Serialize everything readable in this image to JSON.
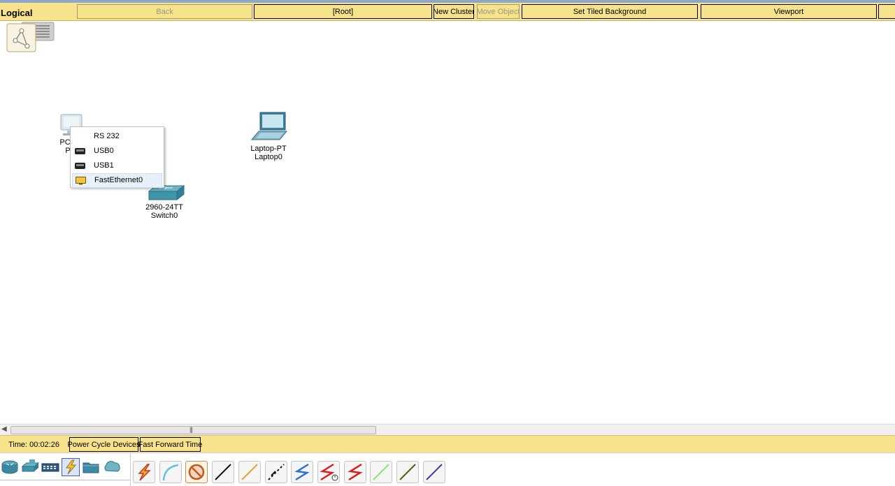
{
  "toolbar": {
    "mode_label": "Logical",
    "back_label": "Back",
    "root_label": "[Root]",
    "new_cluster_label": "New Cluster",
    "move_object_label": "Move Object",
    "set_tiled_background_label": "Set Tiled Background",
    "viewport_label": "Viewport"
  },
  "devices": {
    "pc": {
      "model_label": "PC",
      "name_label": "P"
    },
    "laptop": {
      "model_label": "Laptop-PT",
      "name_label": "Laptop0"
    },
    "switch": {
      "model_label": "2960-24TT",
      "name_label": "Switch0"
    }
  },
  "context_menu": {
    "items": [
      {
        "label": "RS 232",
        "icon": "none"
      },
      {
        "label": "USB0",
        "icon": "usb-port-icon"
      },
      {
        "label": "USB1",
        "icon": "usb-port-icon"
      },
      {
        "label": "FastEthernet0",
        "icon": "ethernet-port-icon"
      }
    ],
    "highlighted_index": 3
  },
  "statusbar": {
    "time_text": "Time: 00:02:26",
    "power_cycle_label": "Power Cycle Devices",
    "fast_forward_label": "Fast Forward Time"
  },
  "palette": {
    "categories": [
      "router-icon",
      "switch-icon",
      "hub-icon",
      "connections-icon",
      "end-device-folder-icon",
      "wan-cloud-icon"
    ],
    "selected_category": "connections-icon",
    "connections": [
      "automatic-connection-icon",
      "console-cable-icon",
      "no-connection-icon",
      "copper-straight-through-icon",
      "copper-cross-over-icon",
      "fiber-icon",
      "phone-line-icon",
      "coaxial-serial-dce-icon",
      "serial-dte-icon",
      "octal-cable-icon",
      "iot-custom-cable-icon",
      "usb-cable-icon"
    ]
  },
  "colors": {
    "toolbar_bg": "#f7e38b",
    "title_strip": "#8fa6c4",
    "menu_highlight": "#e8f1fb",
    "ethernet_port": "#f5c342"
  }
}
